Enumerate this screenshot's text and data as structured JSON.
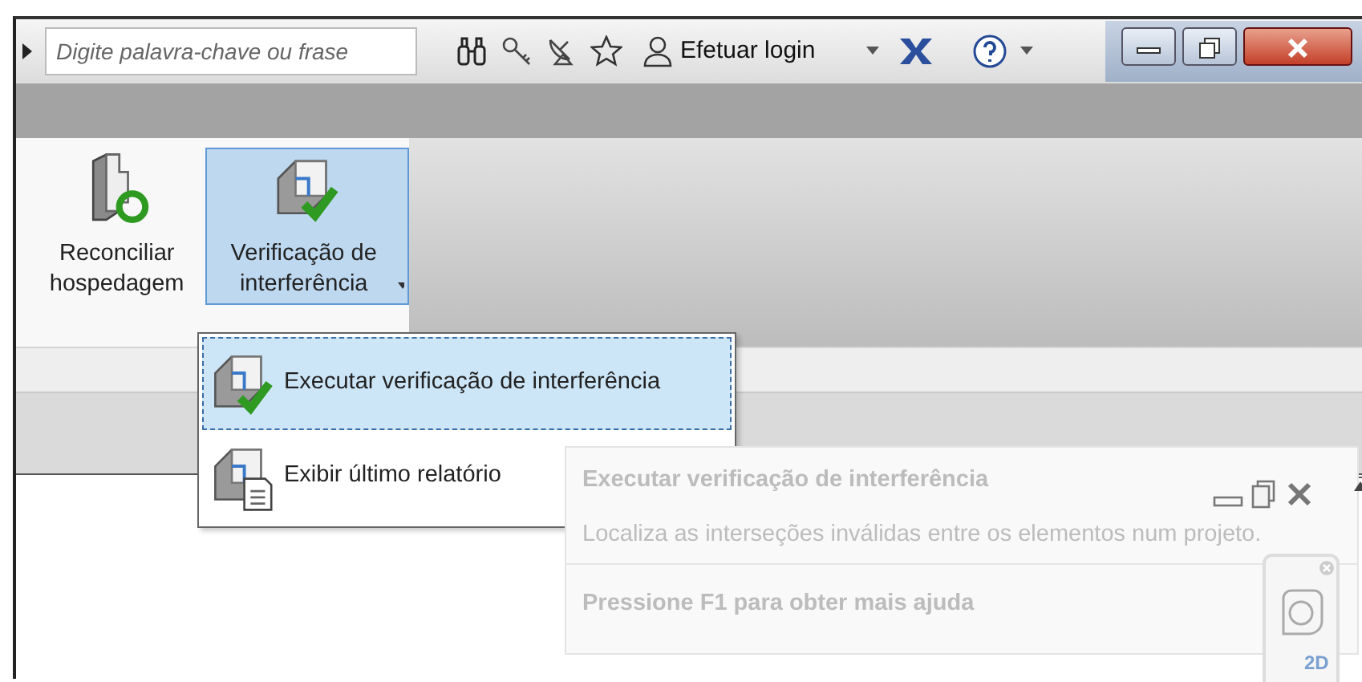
{
  "search": {
    "placeholder": "Digite palavra-chave ou frase"
  },
  "toolbar": {
    "login": "Efetuar login"
  },
  "ribbon": {
    "buttons": [
      {
        "label": "Reconciliar hospedagem",
        "selected": false,
        "dropdown": false,
        "kind": "reconcile"
      },
      {
        "label": "Verificação de interferência",
        "selected": true,
        "dropdown": true,
        "kind": "check"
      }
    ]
  },
  "menu": {
    "items": [
      {
        "label": "Executar verificação de interferência",
        "selected": true,
        "kind": "check"
      },
      {
        "label": "Exibir último relatório",
        "selected": false,
        "kind": "report"
      }
    ]
  },
  "tooltip": {
    "title": "Executar verificação de interferência",
    "description": "Localiza as interseções inválidas entre os elementos num projeto.",
    "help": "Pressione F1 para obter mais ajuda"
  },
  "nav_widget": {
    "label": "2D"
  }
}
